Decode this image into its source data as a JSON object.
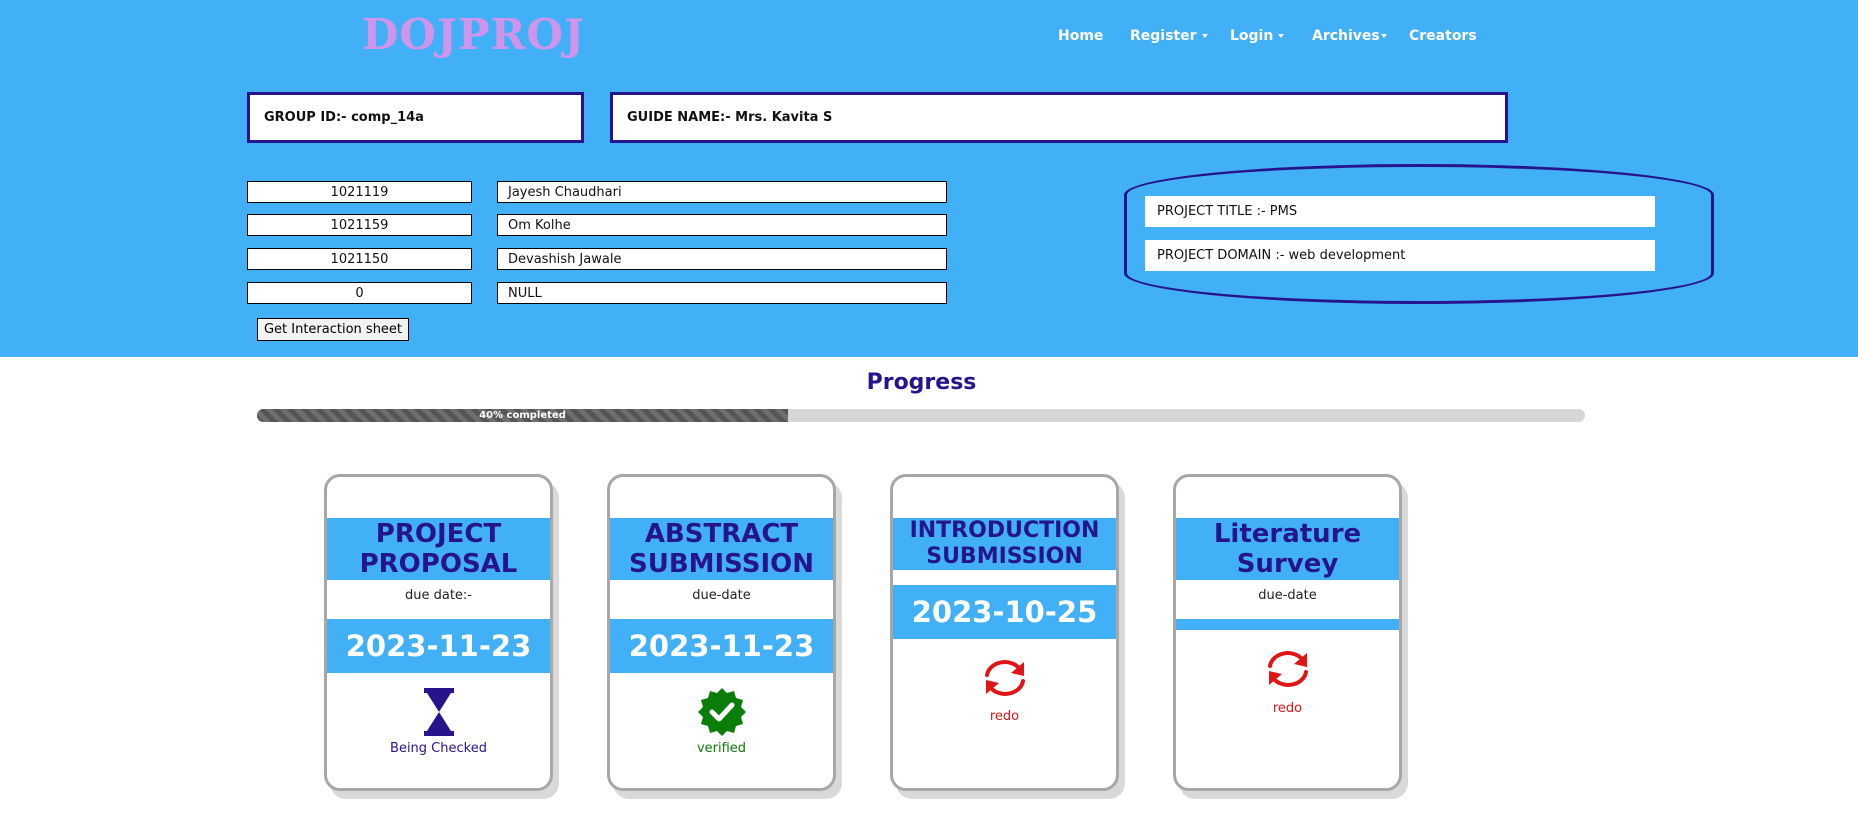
{
  "brand": {
    "logo": "DOJPROJ",
    "logo_color": "#d095ea",
    "header_bg": "#42b0f6"
  },
  "nav": {
    "home": "Home",
    "register": "Register",
    "login": "Login",
    "archives": "Archives",
    "creators": "Creators"
  },
  "group": {
    "id_label": "GROUP ID:- comp_14a",
    "guide_label": "GUIDE NAME:- Mrs. Kavita S"
  },
  "members": [
    {
      "id": "1021119",
      "name": "Jayesh Chaudhari"
    },
    {
      "id": "1021159",
      "name": "Om Kolhe"
    },
    {
      "id": "1021150",
      "name": "Devashish Jawale"
    },
    {
      "id": "0",
      "name": "NULL"
    }
  ],
  "interaction_button": "Get Interaction sheet",
  "project": {
    "title": "PROJECT TITLE :- PMS",
    "domain": "PROJECT DOMAIN :- web development"
  },
  "progress": {
    "heading": "Progress",
    "percent": 40,
    "label": "40% completed"
  },
  "cards": [
    {
      "title": "PROJECT PROPOSAL",
      "due_label": "due date:-",
      "date": "2023-11-23",
      "icon": "hourglass-icon",
      "status": "Being Checked",
      "status_color": "#26148f"
    },
    {
      "title": "ABSTRACT SUBMISSION",
      "due_label": "due-date",
      "date": "2023-11-23",
      "icon": "verified-badge-icon",
      "status": "verified",
      "status_color": "#0a7d0a"
    },
    {
      "title": "INTRODUCTION SUBMISSION",
      "due_label": "",
      "date": "2023-10-25",
      "icon": "redo-icon",
      "status": "redo",
      "status_color": "#e01515"
    },
    {
      "title": "Literature Survey",
      "due_label": "due-date",
      "date": "",
      "icon": "redo-icon",
      "status": "redo",
      "status_color": "#e01515"
    }
  ]
}
